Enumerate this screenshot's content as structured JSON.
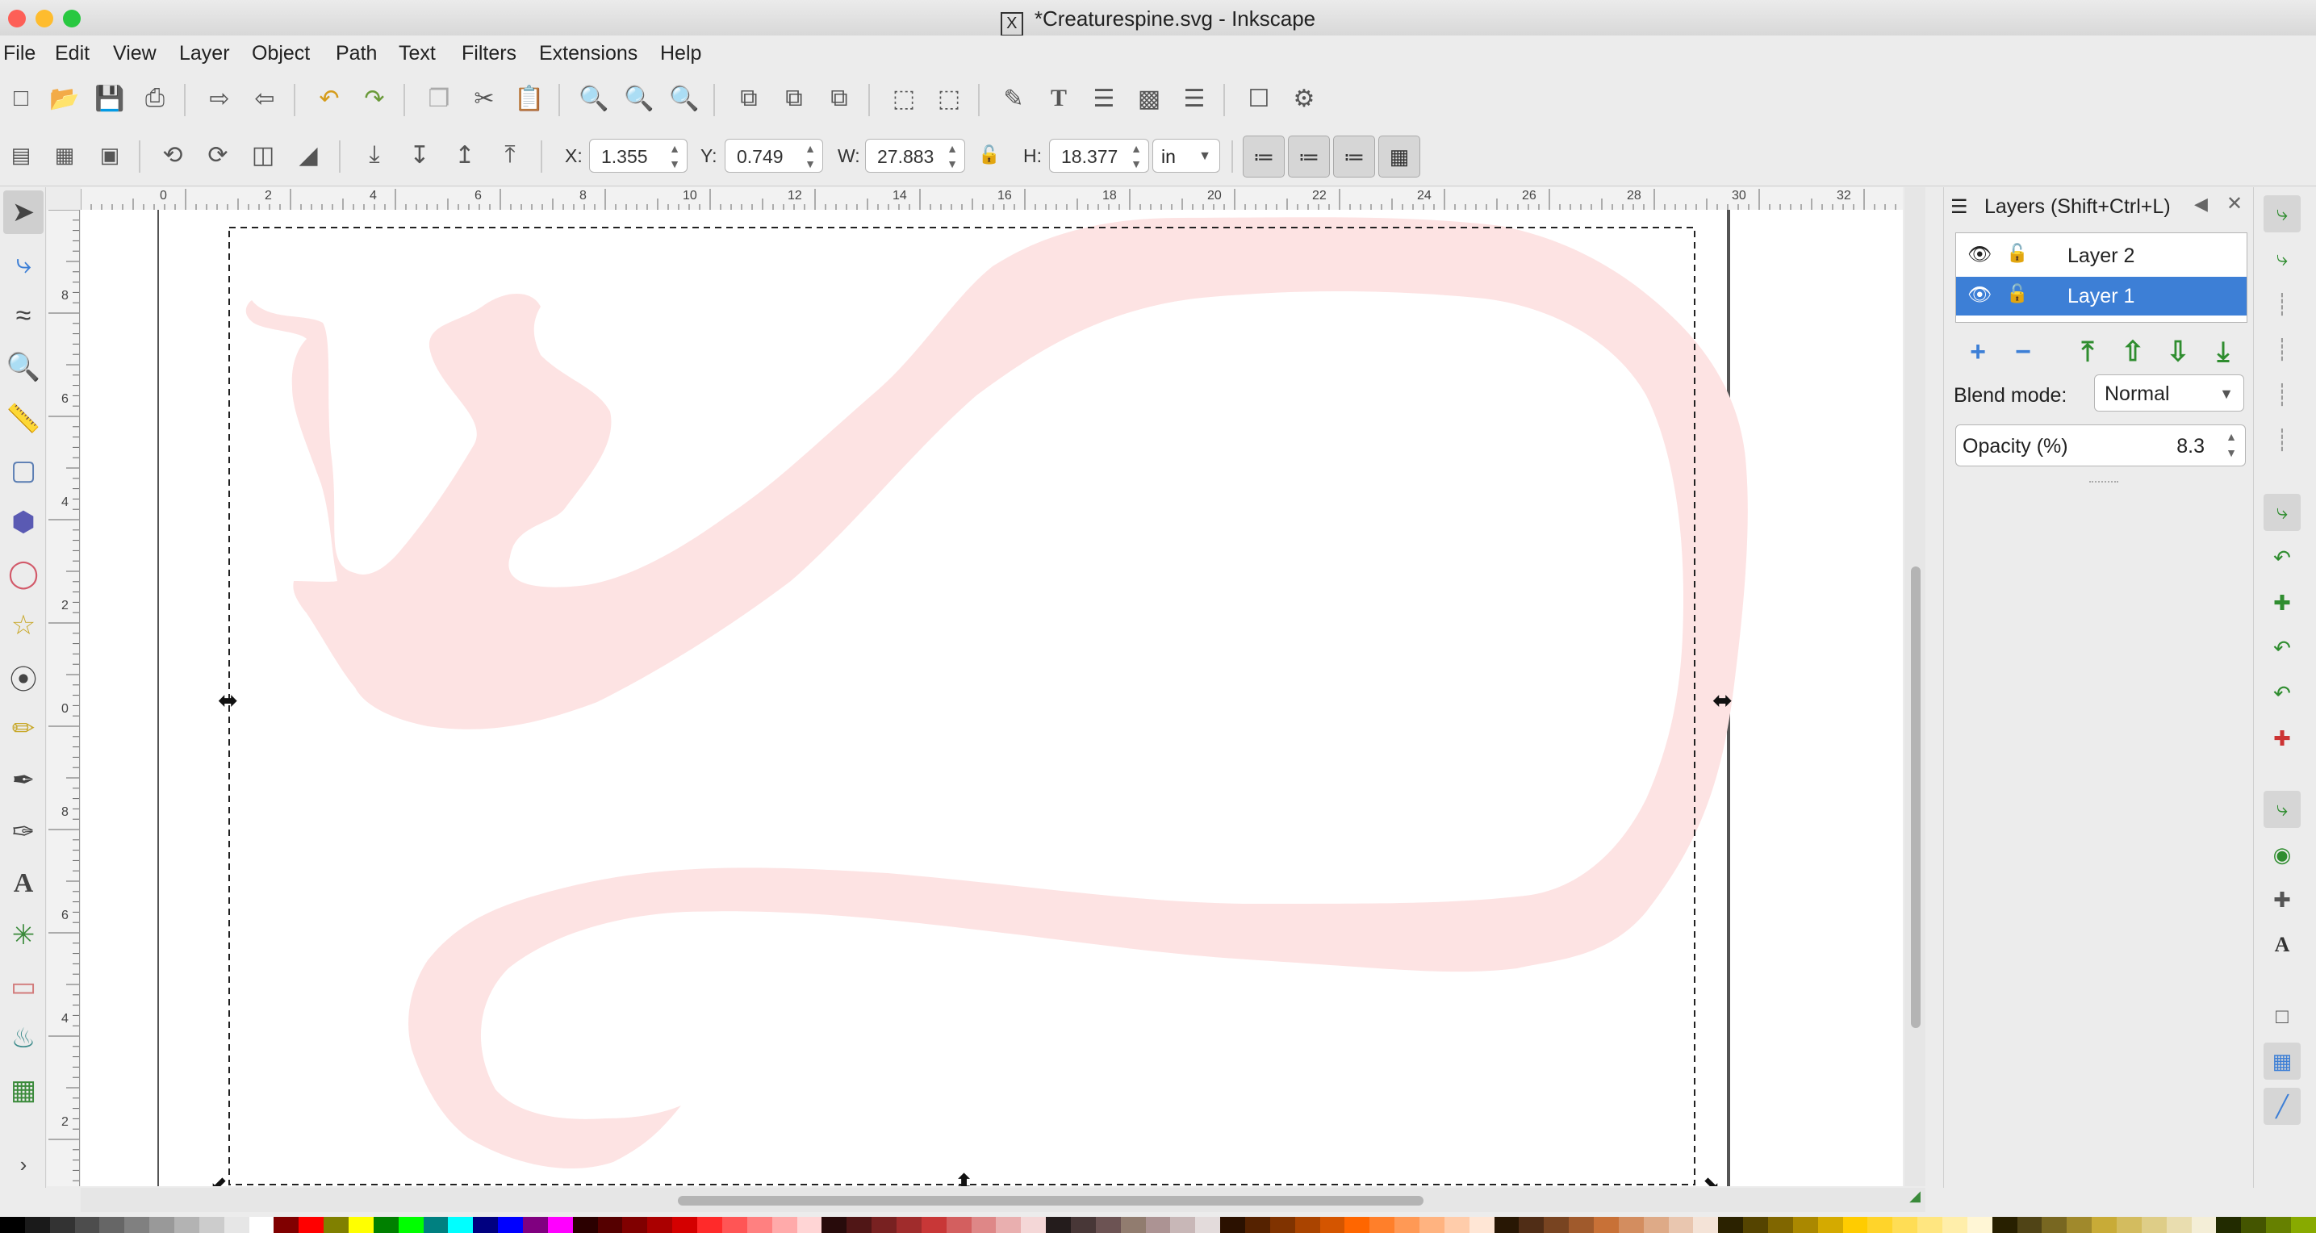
{
  "window": {
    "title": "*Creaturespine.svg - Inkscape",
    "title_icon": "X",
    "traffic_colors": [
      "#fd5f57",
      "#febc2e",
      "#28c840"
    ]
  },
  "menu": [
    "File",
    "Edit",
    "View",
    "Layer",
    "Object",
    "Path",
    "Text",
    "Filters",
    "Extensions",
    "Help"
  ],
  "toolbar2": {
    "x_label": "X:",
    "x_value": "1.355",
    "y_label": "Y:",
    "y_value": "0.749",
    "w_label": "W:",
    "w_value": "27.883",
    "h_label": "H:",
    "h_value": "18.377",
    "unit": "in"
  },
  "ruler": {
    "h_labels": [
      "0",
      "2",
      "4",
      "6",
      "8",
      "10",
      "12",
      "14",
      "16",
      "18",
      "20",
      "22",
      "24",
      "26",
      "28",
      "30",
      "32"
    ],
    "v_labels": [
      "8",
      "6",
      "4",
      "2",
      "0",
      "8",
      "6",
      "4",
      "2"
    ]
  },
  "layers_panel": {
    "title": "Layers (Shift+Ctrl+L)",
    "layers": [
      {
        "name": "Layer 2",
        "selected": false
      },
      {
        "name": "Layer 1",
        "selected": true
      }
    ],
    "blend_label": "Blend mode:",
    "blend_value": "Normal",
    "opacity_label": "Opacity (%)",
    "opacity_value": "8.3"
  },
  "colors": {
    "accent": "#3d7fd6",
    "shape_fill": "#fde3e3",
    "palette": [
      "#000000",
      "#1a1a1a",
      "#333333",
      "#4d4d4d",
      "#666666",
      "#808080",
      "#999999",
      "#b3b3b3",
      "#cccccc",
      "#e6e6e6",
      "#ffffff",
      "#800000",
      "#ff0000",
      "#808000",
      "#ffff00",
      "#008000",
      "#00ff00",
      "#008080",
      "#00ffff",
      "#000080",
      "#0000ff",
      "#800080",
      "#ff00ff",
      "#2b0000",
      "#550000",
      "#800000",
      "#aa0000",
      "#d40000",
      "#ff2a2a",
      "#ff5555",
      "#ff8080",
      "#ffaaaa",
      "#ffd5d5",
      "#280b0b",
      "#501616",
      "#782121",
      "#a02c2c",
      "#c83737",
      "#d35f5f",
      "#de8787",
      "#e9afaf",
      "#f4d7d7",
      "#241c1c",
      "#483737",
      "#6c5353",
      "#917c6f",
      "#ac9393",
      "#c8b7b7",
      "#e3dbdb",
      "#2b1100",
      "#552200",
      "#803300",
      "#aa4400",
      "#d45500",
      "#ff6600",
      "#ff7f2a",
      "#ff9955",
      "#ffb380",
      "#ffccaa",
      "#ffe6d5",
      "#281704",
      "#502d16",
      "#784421",
      "#a05a2c",
      "#c87137",
      "#d38d5f",
      "#deaa87",
      "#e9c6af",
      "#f4e3d7",
      "#2b2200",
      "#554400",
      "#806600",
      "#aa8800",
      "#d4aa00",
      "#ffcc00",
      "#ffd42a",
      "#ffdd55",
      "#ffe680",
      "#ffeeaa",
      "#fff6d5",
      "#282000",
      "#504416",
      "#786721",
      "#a0892c",
      "#c8ab37",
      "#d3bc5f",
      "#decd87",
      "#e9ddaf",
      "#f4eed7",
      "#222b00",
      "#445500",
      "#668000",
      "#88aa00"
    ]
  }
}
